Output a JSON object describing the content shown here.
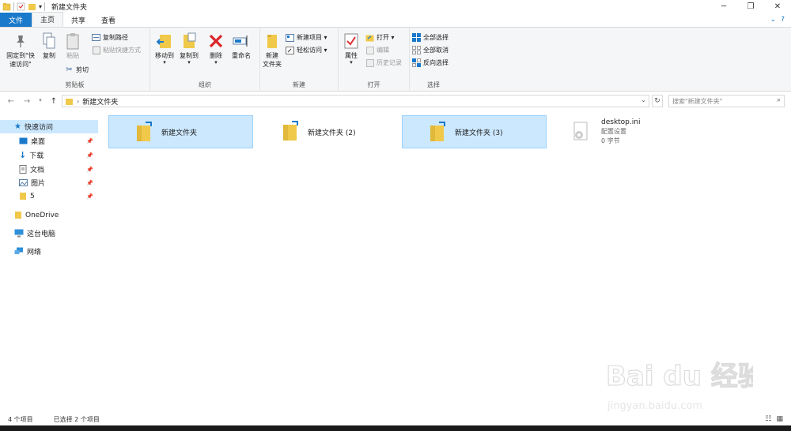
{
  "window": {
    "title": "新建文件夹",
    "controls": [
      "─",
      "❐",
      "✕"
    ]
  },
  "tabs": [
    {
      "label": "文件"
    },
    {
      "label": "主页"
    },
    {
      "label": "共享"
    },
    {
      "label": "查看"
    }
  ],
  "ribbon": {
    "clipboard": {
      "pin_label_1": "固定到\"快",
      "pin_label_2": "速访问\"",
      "copy": "复制",
      "paste": "粘贴",
      "copy_path": "复制路径",
      "paste_shortcut": "粘贴快捷方式",
      "cut": "剪切",
      "group": "剪贴板"
    },
    "organize": {
      "move_to": "移动到",
      "copy_to": "复制到",
      "delete": "删除",
      "rename": "重命名",
      "group": "组织"
    },
    "new": {
      "new_folder_1": "新建",
      "new_folder_2": "文件夹",
      "new_item": "新建项目 ▾",
      "easy_access": "轻松访问 ▾",
      "group": "新建"
    },
    "open": {
      "properties": "属性",
      "open": "打开 ▾",
      "edit": "编辑",
      "history": "历史记录",
      "group": "打开"
    },
    "select": {
      "select_all": "全部选择",
      "select_none": "全部取消",
      "invert": "反向选择",
      "group": "选择"
    }
  },
  "address": {
    "path": "新建文件夹",
    "search_placeholder": "搜索\"新建文件夹\""
  },
  "nav": {
    "quick_access": "快速访问",
    "items": [
      {
        "label": "桌面"
      },
      {
        "label": "下载"
      },
      {
        "label": "文档"
      },
      {
        "label": "图片"
      },
      {
        "label": "5"
      }
    ],
    "onedrive": "OneDrive",
    "this_pc": "这台电脑",
    "network": "网络"
  },
  "files": [
    {
      "name": "新建文件夹",
      "selected": true
    },
    {
      "name": "新建文件夹 (2)",
      "selected": false
    },
    {
      "name": "新建文件夹 (3)",
      "selected": true
    },
    {
      "name": "desktop.ini",
      "type": "配置设置",
      "size": "0 字节"
    }
  ],
  "status": {
    "count": "4 个项目",
    "selected": "已选择 2 个项目"
  },
  "watermark": {
    "brand": "Bai du 经验",
    "url": "jingyan.baidu.com"
  },
  "colors": {
    "accent": "#1979ca",
    "selection": "#cce8ff",
    "folder": "#f0c94a"
  }
}
